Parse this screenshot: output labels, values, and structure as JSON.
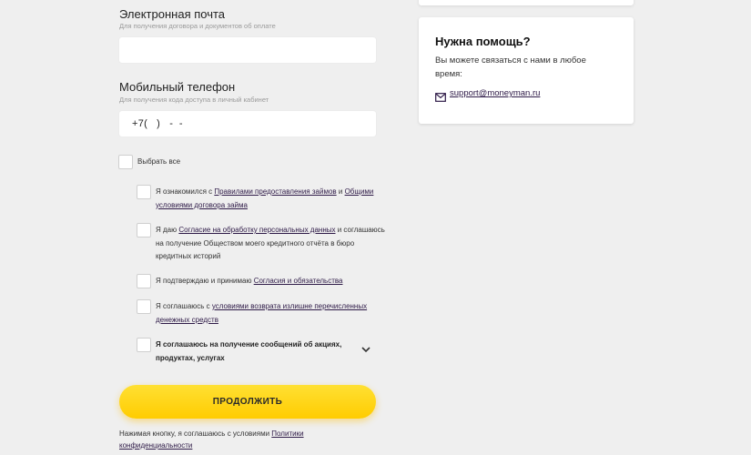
{
  "email": {
    "title": "Электронная почта",
    "hint": "Для получения договора и документов об оплате",
    "value": ""
  },
  "phone": {
    "title": "Мобильный телефон",
    "hint": "Для получения кода доступа в личный кабинет",
    "value": "+7(   )   -  -"
  },
  "select_all": {
    "label": "Выбрать все"
  },
  "consents": [
    {
      "pre": "Я ознакомился с ",
      "link1": "Правилами предоставления займов",
      "mid": " и ",
      "link2": "Общими условиями договора займа",
      "post": ""
    },
    {
      "pre": "Я даю ",
      "link1": "Согласие на обработку персональных данных",
      "post": " и соглашаюсь на получение Обществом моего кредитного отчёта в бюро кредитных историй"
    },
    {
      "pre": "Я подтверждаю и принимаю ",
      "link1": "Согласия и обязательства",
      "post": ""
    },
    {
      "pre": "Я соглашаюсь с ",
      "link1": "условиями возврата излишне перечисленных денежных средств",
      "post": ""
    },
    {
      "text": "Я соглашаюсь на получение сообщений об акциях, продуктах, услугах"
    }
  ],
  "continue_button": {
    "label": "ПРОДОЛЖИТЬ"
  },
  "footnote": {
    "text": "Нажимая кнопку, я соглашаюсь с условиями ",
    "link": "Политики конфиденциальности"
  },
  "help": {
    "title": "Нужна помощь?",
    "text": "Вы можете связаться с нами в любое время:",
    "email": "support@moneyman.ru",
    "mail_icon": "mail-icon"
  },
  "colors": {
    "background": "#efefef",
    "button": "#ffd600",
    "link": "#2e1a47"
  }
}
